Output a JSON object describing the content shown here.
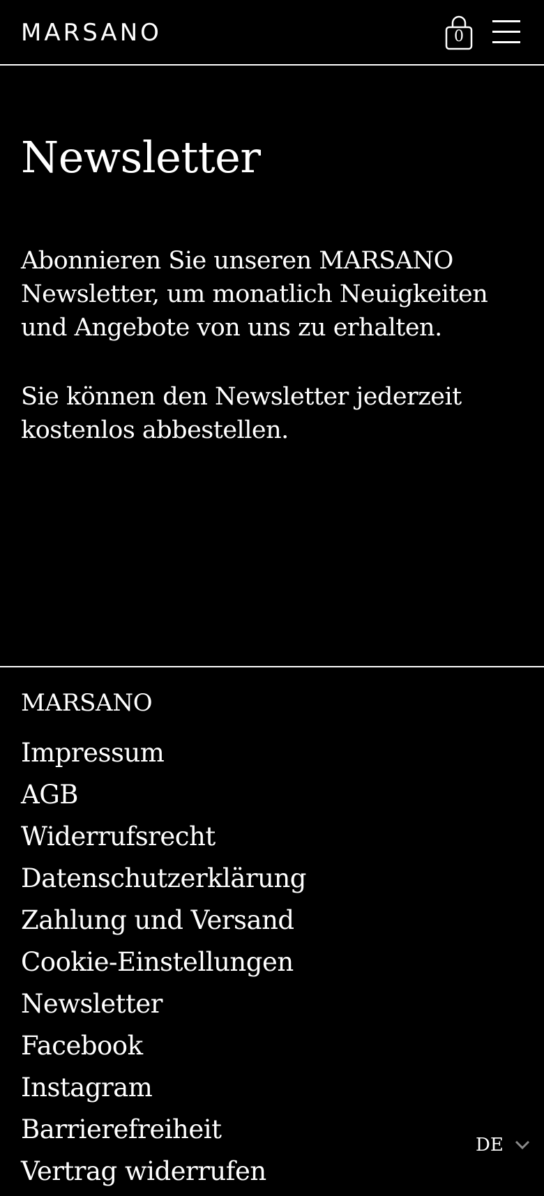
{
  "header": {
    "logo": "MARSANO",
    "cart_count": "0"
  },
  "main": {
    "title": "Newsletter",
    "intro": "Abonnieren Sie unseren MARSANO Newsletter, um monatlich Neuigkeiten und Angebote von uns zu erhalten.",
    "unsubscribe_note": "Sie können den Newsletter jederzeit kostenlos abbestellen."
  },
  "footer": {
    "brand": "MARSANO",
    "links": [
      "Impressum",
      "AGB",
      "Widerrufsrecht",
      "Datenschutzerklärung",
      "Zahlung und Versand",
      "Cookie-Einstellungen",
      "Newsletter",
      "Facebook",
      "Instagram",
      "Barrierefreiheit",
      "Vertrag widerrufen"
    ]
  },
  "language": {
    "selected": "DE"
  },
  "icons": {
    "cart": "shopping-bag-icon",
    "menu": "hamburger-menu-icon",
    "language_dropdown": "chevron-down-icon"
  },
  "colors": {
    "background": "#000000",
    "foreground": "#ffffff"
  }
}
